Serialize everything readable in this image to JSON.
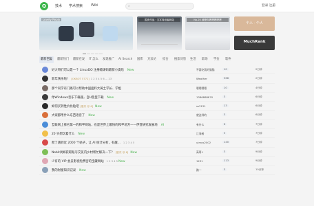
{
  "nav": {
    "logo_glyph": "Q",
    "links": [
      "技术",
      "学术搜索",
      "Wiki"
    ],
    "search_icon": "⌕",
    "login": "登录 注册"
  },
  "banners": {
    "b1_label": "Lovely Reply",
    "b2_label": "国庆作品 · 文字特设者网站",
    "b3_label": "No.20 我是你嗯嗯嗯嗯嗯",
    "b4_label": "个人 · 个人",
    "b5_label": "MuchRank"
  },
  "tabs": [
    "最新回复",
    "最新热门",
    "最新在发",
    "IT 怎么",
    "发现推广",
    "AI Search",
    "国库",
    "方法论",
    "综合",
    "搜索问答",
    "生活",
    "职场",
    "学金",
    "软件"
  ],
  "rows": [
    {
      "title": "好大哥们可以是一个 LinuxDO 注册邀请码最新小奥哈",
      "new": "New",
      "pages": "",
      "badge": "",
      "author": "不要吃我的猫猫",
      "stat": "10",
      "time": "2分钟",
      "color": "#6a88d8"
    },
    {
      "title": "新年快乐啦！",
      "new": "",
      "pages": "1 2 3 4 5 6 ... 23",
      "badge": "[OKBOT 5772]",
      "author": "Weather",
      "stat": "568",
      "time": "2分钟",
      "color": "#333"
    },
    {
      "title": "那个同学有门路可以帮助中国面料大黄土学长、学姐",
      "new": "",
      "pages": "",
      "badge": "",
      "author": "嗯嗯嗯嗯",
      "stat": "10",
      "time": "4分钟",
      "color": "#7a6c66"
    },
    {
      "title": "你Windows音乐下载器，自U盘里下载",
      "new": "New",
      "pages": "",
      "badge": "",
      "author": "1386888870",
      "stat": "3",
      "time": "6分钟",
      "color": "#3a3a3a"
    },
    {
      "title": "如何买到性价比贴吧",
      "new": "New",
      "pages": "",
      "badge": "[股东 @ 6]",
      "author": "ss3131",
      "stat": "13",
      "time": "6分钟",
      "color": "#2a2a2a"
    },
    {
      "title": "大家都用什么东西语音了",
      "new": "New",
      "pages": "",
      "badge": "",
      "author": "就这样的",
      "stat": "3",
      "time": "6分钟",
      "color": "#d96f3a"
    },
    {
      "title": "互联网上排名第一的和平网站，也是世界上最快的和平地方——伊登研究发展地",
      "new": "AI",
      "pages": "",
      "badge": "",
      "author": "有什么",
      "stat": "6",
      "time": "7分钟",
      "color": "#4b8dd8"
    },
    {
      "title": "20 岁想玩着什么",
      "new": "New",
      "pages": "",
      "badge": "",
      "author": "江海者",
      "stat": "5",
      "time": "7分钟",
      "color": "#f1c04a"
    },
    {
      "title": "爬了遇到近 2000 个帖子，让 AI 统计分析，有趣...",
      "new": "",
      "pages": "1 2 3 4 5",
      "badge": "",
      "author": "uimos2002",
      "stat": "140",
      "time": "7分钟",
      "color": "#d84a4a"
    },
    {
      "title": "Nobit试如获取账号交友内乡村帮忙解决一下？",
      "new": "New",
      "pages": "",
      "badge": "[股东 @ 6]",
      "author": "高哥1",
      "stat": "3",
      "time": "9分钟",
      "color": "#7fbf57"
    },
    {
      "title": "少有的 VIP 会员影视免费密的宝藏网站",
      "new": "New",
      "pages": "1 2 3 4 5",
      "badge": "",
      "author": "1231",
      "stat": "113",
      "time": "9分钟",
      "color": "#e0a7b4"
    },
    {
      "title": "我的财富知识记录",
      "new": "New",
      "pages": "",
      "badge": "",
      "author": "路一",
      "stat": "3",
      "time": "10分钟",
      "color": "#8aa0b8"
    }
  ]
}
